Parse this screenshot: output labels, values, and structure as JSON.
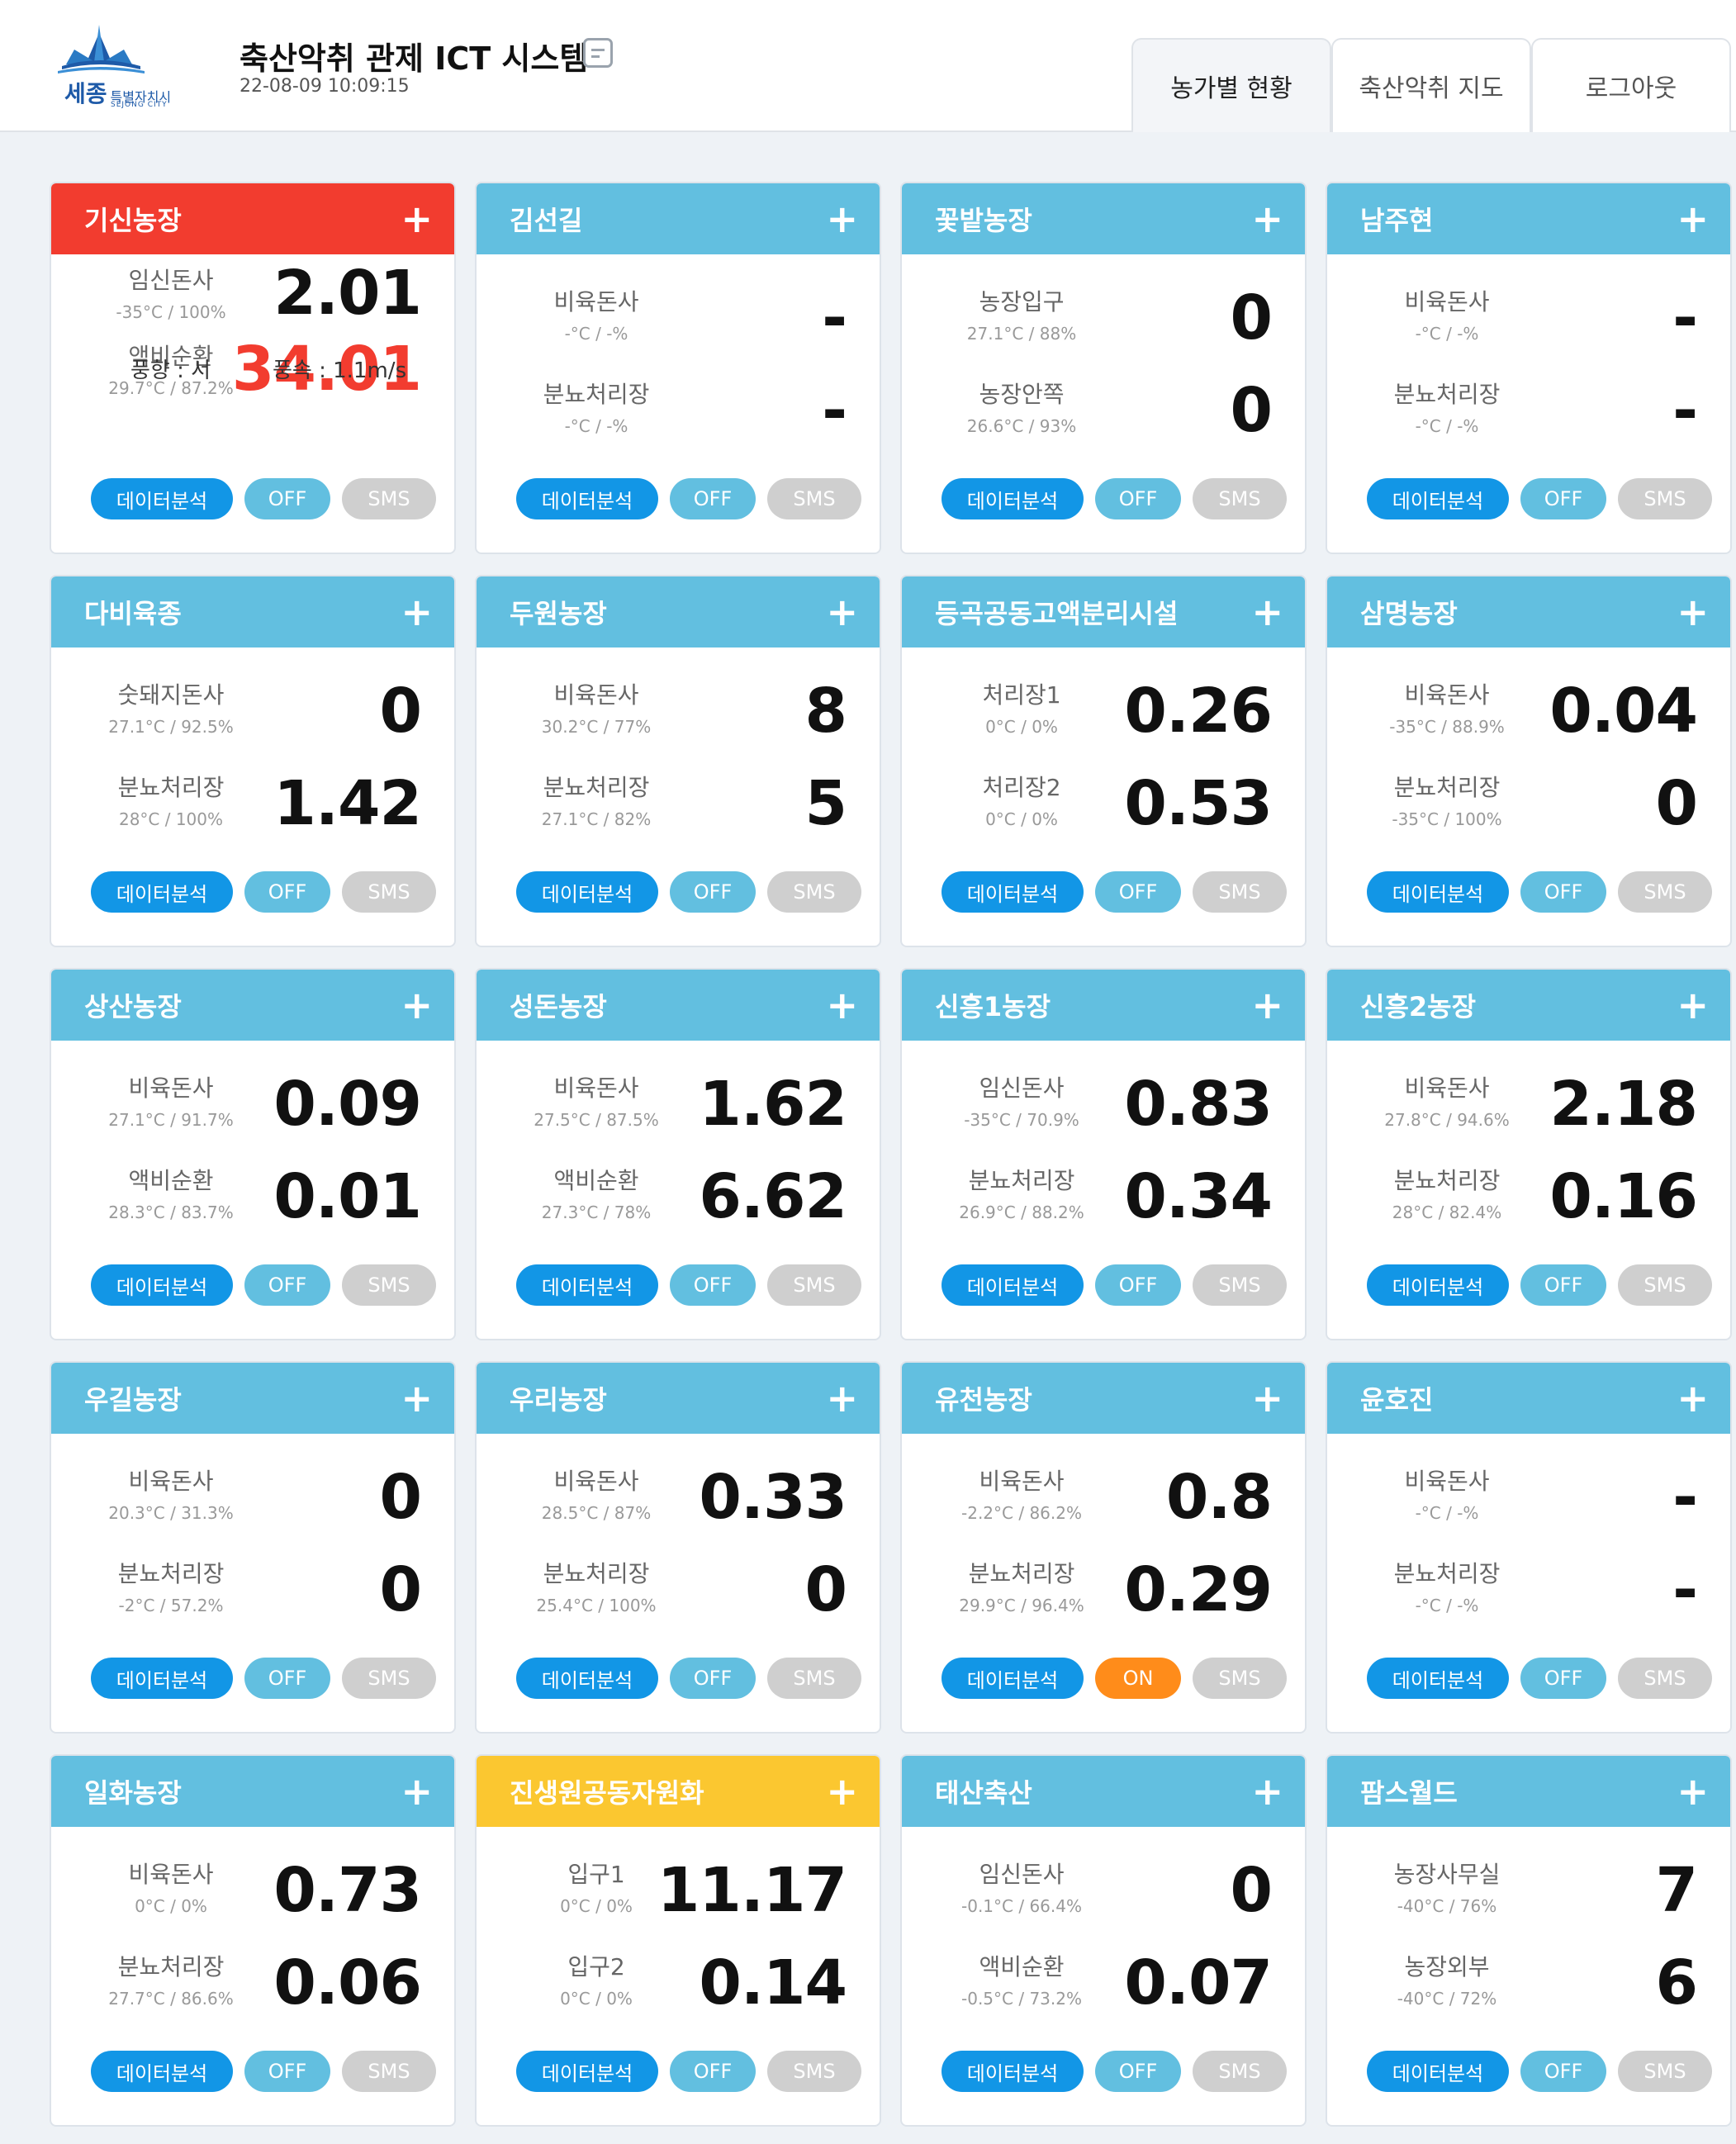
{
  "header": {
    "logo_text": "세종",
    "logo_city": "특별자치시",
    "logo_sub": "SEJONG CITY",
    "title": "축산악취 관제 ICT 시스템",
    "timestamp": "22-08-09 10:09:15",
    "nav": [
      "농가별 현황",
      "축산악취 지도",
      "로그아웃"
    ],
    "active_nav": "농가별 현황"
  },
  "labels": {
    "data": "데이터분석",
    "off": "OFF",
    "on": "ON",
    "sms": "SMS",
    "plus": "+"
  },
  "colors": {
    "header_default": "#62bfe0",
    "header_alarm": "#f23c2f",
    "header_warn": "#fbc730",
    "data_btn": "#1296e6",
    "on_btn": "#ff8c1a",
    "sms_btn": "#cfcfcf"
  },
  "farms": [
    {
      "name": "기신농장",
      "status": "alarm",
      "toggle": "OFF",
      "sensors": [
        {
          "name": "임신돈사",
          "env": "-35°C / 100%",
          "value": "2.01",
          "alert": false
        },
        {
          "name": "액비순환",
          "env": "29.7°C / 87.2%",
          "value": "34.01",
          "alert": true
        }
      ],
      "wind": {
        "dir": "풍향 : 서",
        "speed": "풍속 : 1.1m/s"
      }
    },
    {
      "name": "김선길",
      "status": "normal",
      "toggle": "OFF",
      "sensors": [
        {
          "name": "비육돈사",
          "env": "-°C / -%",
          "value": "-"
        },
        {
          "name": "분뇨처리장",
          "env": "-°C / -%",
          "value": "-"
        }
      ]
    },
    {
      "name": "꽃밭농장",
      "status": "normal",
      "toggle": "OFF",
      "sensors": [
        {
          "name": "농장입구",
          "env": "27.1°C / 88%",
          "value": "0"
        },
        {
          "name": "농장안쪽",
          "env": "26.6°C / 93%",
          "value": "0"
        }
      ]
    },
    {
      "name": "남주현",
      "status": "normal",
      "toggle": "OFF",
      "sensors": [
        {
          "name": "비육돈사",
          "env": "-°C / -%",
          "value": "-"
        },
        {
          "name": "분뇨처리장",
          "env": "-°C / -%",
          "value": "-"
        }
      ]
    },
    {
      "name": "다비육종",
      "status": "normal",
      "toggle": "OFF",
      "sensors": [
        {
          "name": "숫돼지돈사",
          "env": "27.1°C / 92.5%",
          "value": "0"
        },
        {
          "name": "분뇨처리장",
          "env": "28°C / 100%",
          "value": "1.42"
        }
      ]
    },
    {
      "name": "두원농장",
      "status": "normal",
      "toggle": "OFF",
      "sensors": [
        {
          "name": "비육돈사",
          "env": "30.2°C / 77%",
          "value": "8"
        },
        {
          "name": "분뇨처리장",
          "env": "27.1°C / 82%",
          "value": "5"
        }
      ]
    },
    {
      "name": "등곡공동고액분리시설",
      "status": "normal",
      "toggle": "OFF",
      "sensors": [
        {
          "name": "처리장1",
          "env": "0°C / 0%",
          "value": "0.26"
        },
        {
          "name": "처리장2",
          "env": "0°C / 0%",
          "value": "0.53"
        }
      ]
    },
    {
      "name": "삼명농장",
      "status": "normal",
      "toggle": "OFF",
      "sensors": [
        {
          "name": "비육돈사",
          "env": "-35°C / 88.9%",
          "value": "0.04"
        },
        {
          "name": "분뇨처리장",
          "env": "-35°C / 100%",
          "value": "0"
        }
      ]
    },
    {
      "name": "상산농장",
      "status": "normal",
      "toggle": "OFF",
      "sensors": [
        {
          "name": "비육돈사",
          "env": "27.1°C / 91.7%",
          "value": "0.09"
        },
        {
          "name": "액비순환",
          "env": "28.3°C / 83.7%",
          "value": "0.01"
        }
      ]
    },
    {
      "name": "성돈농장",
      "status": "normal",
      "toggle": "OFF",
      "sensors": [
        {
          "name": "비육돈사",
          "env": "27.5°C / 87.5%",
          "value": "1.62"
        },
        {
          "name": "액비순환",
          "env": "27.3°C / 78%",
          "value": "6.62"
        }
      ]
    },
    {
      "name": "신흥1농장",
      "status": "normal",
      "toggle": "OFF",
      "sensors": [
        {
          "name": "임신돈사",
          "env": "-35°C / 70.9%",
          "value": "0.83"
        },
        {
          "name": "분뇨처리장",
          "env": "26.9°C / 88.2%",
          "value": "0.34"
        }
      ]
    },
    {
      "name": "신흥2농장",
      "status": "normal",
      "toggle": "OFF",
      "sensors": [
        {
          "name": "비육돈사",
          "env": "27.8°C / 94.6%",
          "value": "2.18"
        },
        {
          "name": "분뇨처리장",
          "env": "28°C / 82.4%",
          "value": "0.16"
        }
      ]
    },
    {
      "name": "우길농장",
      "status": "normal",
      "toggle": "OFF",
      "sensors": [
        {
          "name": "비육돈사",
          "env": "20.3°C / 31.3%",
          "value": "0"
        },
        {
          "name": "분뇨처리장",
          "env": "-2°C / 57.2%",
          "value": "0"
        }
      ]
    },
    {
      "name": "우리농장",
      "status": "normal",
      "toggle": "OFF",
      "sensors": [
        {
          "name": "비육돈사",
          "env": "28.5°C / 87%",
          "value": "0.33"
        },
        {
          "name": "분뇨처리장",
          "env": "25.4°C / 100%",
          "value": "0"
        }
      ]
    },
    {
      "name": "유천농장",
      "status": "normal",
      "toggle": "ON",
      "sensors": [
        {
          "name": "비육돈사",
          "env": "-2.2°C / 86.2%",
          "value": "0.8"
        },
        {
          "name": "분뇨처리장",
          "env": "29.9°C / 96.4%",
          "value": "0.29"
        }
      ]
    },
    {
      "name": "윤호진",
      "status": "normal",
      "toggle": "OFF",
      "sensors": [
        {
          "name": "비육돈사",
          "env": "-°C / -%",
          "value": "-"
        },
        {
          "name": "분뇨처리장",
          "env": "-°C / -%",
          "value": "-"
        }
      ]
    },
    {
      "name": "일화농장",
      "status": "normal",
      "toggle": "OFF",
      "sensors": [
        {
          "name": "비육돈사",
          "env": "0°C / 0%",
          "value": "0.73"
        },
        {
          "name": "분뇨처리장",
          "env": "27.7°C / 86.6%",
          "value": "0.06"
        }
      ]
    },
    {
      "name": "진생원공동자원화",
      "status": "warn",
      "toggle": "OFF",
      "sensors": [
        {
          "name": "입구1",
          "env": "0°C / 0%",
          "value": "11.17"
        },
        {
          "name": "입구2",
          "env": "0°C / 0%",
          "value": "0.14"
        }
      ]
    },
    {
      "name": "태산축산",
      "status": "normal",
      "toggle": "OFF",
      "sensors": [
        {
          "name": "임신돈사",
          "env": "-0.1°C / 66.4%",
          "value": "0"
        },
        {
          "name": "액비순환",
          "env": "-0.5°C / 73.2%",
          "value": "0.07"
        }
      ]
    },
    {
      "name": "팜스월드",
      "status": "normal",
      "toggle": "OFF",
      "sensors": [
        {
          "name": "농장사무실",
          "env": "-40°C / 76%",
          "value": "7"
        },
        {
          "name": "농장외부",
          "env": "-40°C / 72%",
          "value": "6"
        }
      ]
    }
  ]
}
